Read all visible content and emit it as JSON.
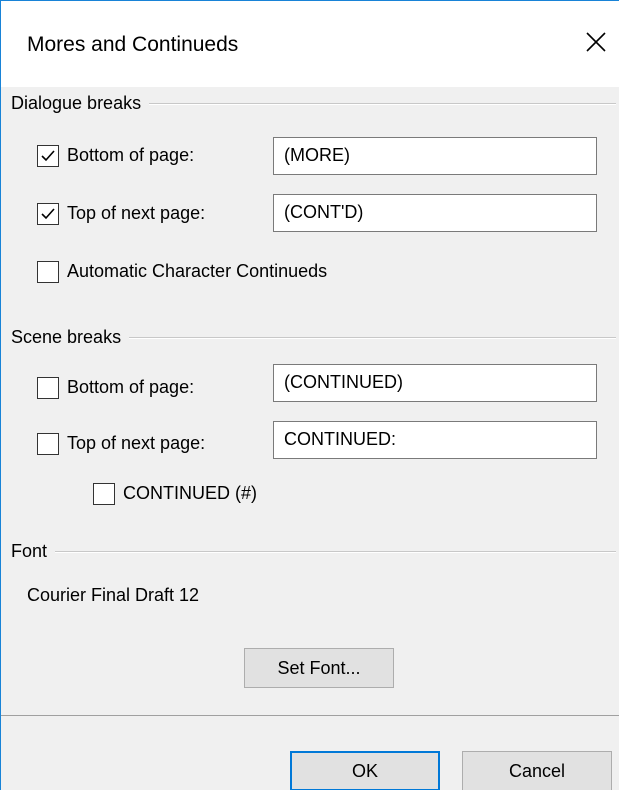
{
  "window": {
    "title": "Mores and Continueds"
  },
  "dialogue_breaks": {
    "group_label": "Dialogue breaks",
    "bottom_of_page": {
      "label": "Bottom of page:",
      "checked": true,
      "value": "(MORE)"
    },
    "top_of_next_page": {
      "label": "Top of next page:",
      "checked": true,
      "value": "(CONT'D)"
    },
    "automatic": {
      "label": "Automatic Character Continueds",
      "checked": false
    }
  },
  "scene_breaks": {
    "group_label": "Scene breaks",
    "bottom_of_page": {
      "label": "Bottom of page:",
      "checked": false,
      "value": "(CONTINUED)"
    },
    "top_of_next_page": {
      "label": "Top of next page:",
      "checked": false,
      "value": "CONTINUED:"
    },
    "continued_number": {
      "label": "CONTINUED (#)",
      "checked": false
    }
  },
  "font": {
    "group_label": "Font",
    "current": "Courier Final Draft 12",
    "set_font_label": "Set Font..."
  },
  "footer": {
    "ok_label": "OK",
    "cancel_label": "Cancel"
  },
  "colors": {
    "accent": "#0078d7",
    "window_border": "#1883d7",
    "client_bg": "#f0f0f0"
  }
}
